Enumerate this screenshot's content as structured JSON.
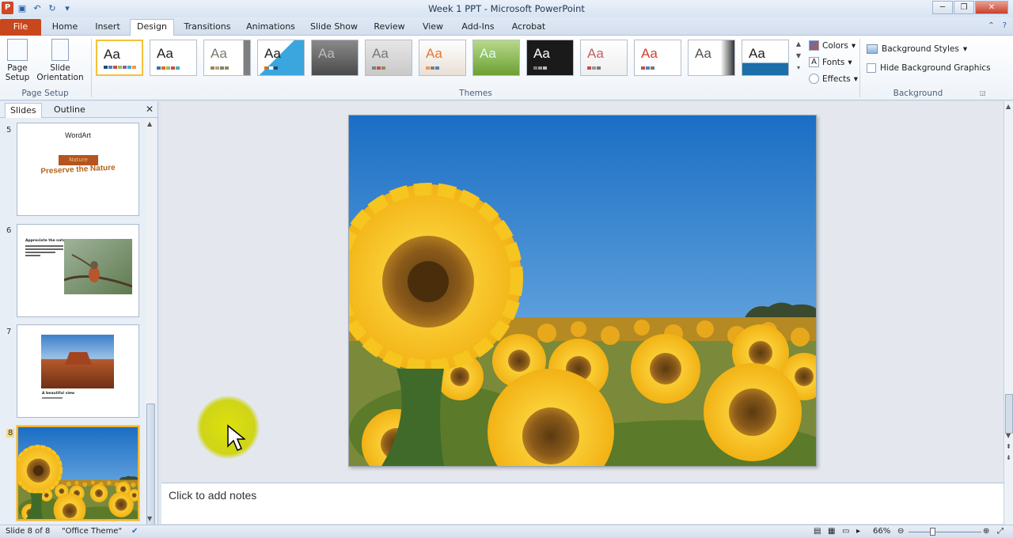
{
  "window": {
    "title": "Week 1 PPT  -  Microsoft PowerPoint"
  },
  "ribbon_tabs": {
    "file": "File",
    "home": "Home",
    "insert": "Insert",
    "design": "Design",
    "transitions": "Transitions",
    "animations": "Animations",
    "slideshow": "Slide Show",
    "review": "Review",
    "view": "View",
    "addins": "Add-Ins",
    "acrobat": "Acrobat"
  },
  "page_setup": {
    "page_setup_label": "Page Setup",
    "orientation_label": "Slide Orientation",
    "group": "Page Setup"
  },
  "themes": {
    "group": "Themes",
    "sample": "Aa",
    "colors": "Colors",
    "fonts": "Fonts",
    "effects": "Effects"
  },
  "background": {
    "group": "Background",
    "styles": "Background Styles",
    "hide_graphics": "Hide Background Graphics"
  },
  "pane": {
    "tab_slides": "Slides",
    "tab_outline": "Outline",
    "slides": [
      {
        "num": "5",
        "title": "WordArt",
        "art": "Preserve the Nature",
        "box": "Nature"
      },
      {
        "num": "6",
        "title": "Appreciate the nature"
      },
      {
        "num": "7",
        "caption": "A beautiful view"
      },
      {
        "num": "8"
      }
    ]
  },
  "notes": {
    "placeholder": "Click to add notes"
  },
  "status": {
    "slide": "Slide 8 of 8",
    "theme": "\"Office Theme\"",
    "zoom": "66%"
  }
}
